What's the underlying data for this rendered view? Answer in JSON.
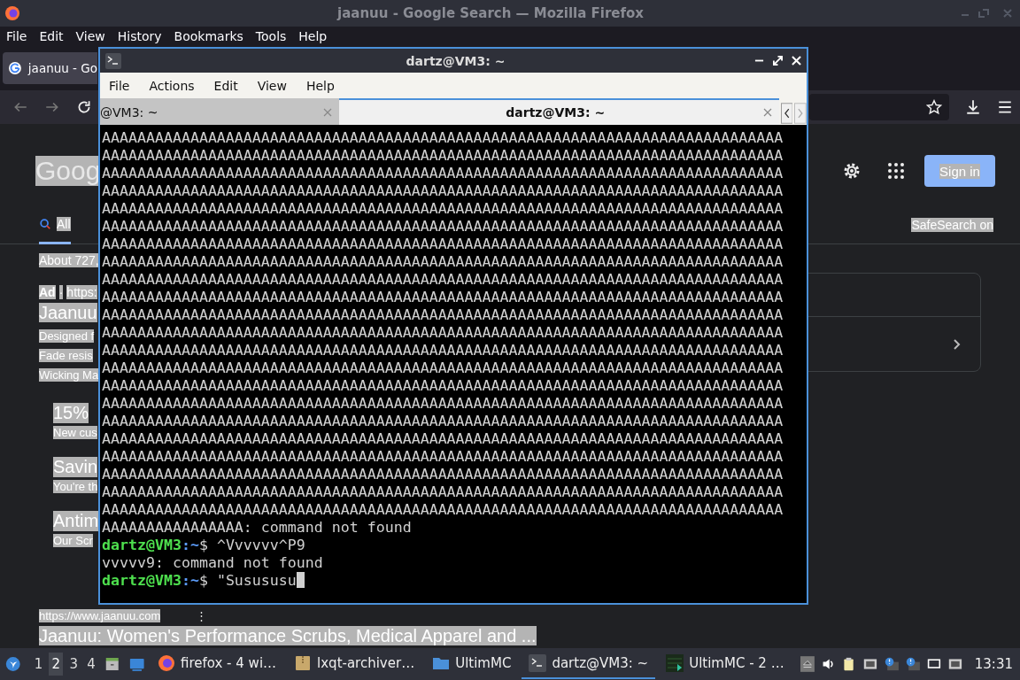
{
  "firefox": {
    "title": "jaanuu - Google Search — Mozilla Firefox",
    "menu": [
      "File",
      "Edit",
      "View",
      "History",
      "Bookmarks",
      "Tools",
      "Help"
    ],
    "tab": {
      "label": "jaanuu - Go",
      "selected": true
    },
    "google": {
      "logo": "Goog",
      "sign_in": "Sign in",
      "nav_tab": {
        "label": "All",
        "selected": true
      },
      "safesearch": "SafeSearch on",
      "results_left": [
        {
          "kind": "stats",
          "text": "About 727,"
        },
        {
          "kind": "adline",
          "badge": "Ad",
          "dot": "·",
          "text": "https:"
        },
        {
          "kind": "title",
          "text": "Jaanuu"
        },
        {
          "kind": "snippet",
          "text": "Designed f"
        },
        {
          "kind": "snippet",
          "text": "Fade resis"
        },
        {
          "kind": "snippet",
          "text": "Wicking Ma"
        },
        {
          "kind": "sublink",
          "title": "15%",
          "text": "New cus"
        },
        {
          "kind": "sublink",
          "title": "Savin",
          "text": "You're th"
        },
        {
          "kind": "sublink",
          "title": "Antim",
          "text": "Our Scr"
        }
      ],
      "organic": {
        "url": "https://www.jaanuu.com",
        "more": "⋮",
        "title": "Jaanuu: Women's Performance Scrubs, Medical Apparel and ..."
      }
    }
  },
  "terminal": {
    "title": "dartz@VM3: ~",
    "menu": [
      "File",
      "Actions",
      "Edit",
      "View",
      "Help"
    ],
    "tabs": [
      {
        "label": "@VM3: ~",
        "selected": false
      },
      {
        "label": "dartz@VM3: ~",
        "selected": true
      }
    ],
    "lines": [
      {
        "kind": "output",
        "text": "AAAAAAAAAAAAAAAAAAAAAAAAAAAAAAAAAAAAAAAAAAAAAAAAAAAAAAAAAAAAAAAAAAAAAAAAAAAAA"
      },
      {
        "kind": "output",
        "text": "AAAAAAAAAAAAAAAAAAAAAAAAAAAAAAAAAAAAAAAAAAAAAAAAAAAAAAAAAAAAAAAAAAAAAAAAAAAAA"
      },
      {
        "kind": "output",
        "text": "AAAAAAAAAAAAAAAAAAAAAAAAAAAAAAAAAAAAAAAAAAAAAAAAAAAAAAAAAAAAAAAAAAAAAAAAAAAAA"
      },
      {
        "kind": "output",
        "text": "AAAAAAAAAAAAAAAAAAAAAAAAAAAAAAAAAAAAAAAAAAAAAAAAAAAAAAAAAAAAAAAAAAAAAAAAAAAAA"
      },
      {
        "kind": "output",
        "text": "AAAAAAAAAAAAAAAAAAAAAAAAAAAAAAAAAAAAAAAAAAAAAAAAAAAAAAAAAAAAAAAAAAAAAAAAAAAAA"
      },
      {
        "kind": "output",
        "text": "AAAAAAAAAAAAAAAAAAAAAAAAAAAAAAAAAAAAAAAAAAAAAAAAAAAAAAAAAAAAAAAAAAAAAAAAAAAAA"
      },
      {
        "kind": "output",
        "text": "AAAAAAAAAAAAAAAAAAAAAAAAAAAAAAAAAAAAAAAAAAAAAAAAAAAAAAAAAAAAAAAAAAAAAAAAAAAAA"
      },
      {
        "kind": "output",
        "text": "AAAAAAAAAAAAAAAAAAAAAAAAAAAAAAAAAAAAAAAAAAAAAAAAAAAAAAAAAAAAAAAAAAAAAAAAAAAAA"
      },
      {
        "kind": "output",
        "text": "AAAAAAAAAAAAAAAAAAAAAAAAAAAAAAAAAAAAAAAAAAAAAAAAAAAAAAAAAAAAAAAAAAAAAAAAAAAAA"
      },
      {
        "kind": "output",
        "text": "AAAAAAAAAAAAAAAAAAAAAAAAAAAAAAAAAAAAAAAAAAAAAAAAAAAAAAAAAAAAAAAAAAAAAAAAAAAAA"
      },
      {
        "kind": "output",
        "text": "AAAAAAAAAAAAAAAAAAAAAAAAAAAAAAAAAAAAAAAAAAAAAAAAAAAAAAAAAAAAAAAAAAAAAAAAAAAAA"
      },
      {
        "kind": "output",
        "text": "AAAAAAAAAAAAAAAAAAAAAAAAAAAAAAAAAAAAAAAAAAAAAAAAAAAAAAAAAAAAAAAAAAAAAAAAAAAAA"
      },
      {
        "kind": "output",
        "text": "AAAAAAAAAAAAAAAAAAAAAAAAAAAAAAAAAAAAAAAAAAAAAAAAAAAAAAAAAAAAAAAAAAAAAAAAAAAAA"
      },
      {
        "kind": "output",
        "text": "AAAAAAAAAAAAAAAAAAAAAAAAAAAAAAAAAAAAAAAAAAAAAAAAAAAAAAAAAAAAAAAAAAAAAAAAAAAAA"
      },
      {
        "kind": "output",
        "text": "AAAAAAAAAAAAAAAAAAAAAAAAAAAAAAAAAAAAAAAAAAAAAAAAAAAAAAAAAAAAAAAAAAAAAAAAAAAAA"
      },
      {
        "kind": "output",
        "text": "AAAAAAAAAAAAAAAAAAAAAAAAAAAAAAAAAAAAAAAAAAAAAAAAAAAAAAAAAAAAAAAAAAAAAAAAAAAAA"
      },
      {
        "kind": "output",
        "text": "AAAAAAAAAAAAAAAAAAAAAAAAAAAAAAAAAAAAAAAAAAAAAAAAAAAAAAAAAAAAAAAAAAAAAAAAAAAAA"
      },
      {
        "kind": "output",
        "text": "AAAAAAAAAAAAAAAAAAAAAAAAAAAAAAAAAAAAAAAAAAAAAAAAAAAAAAAAAAAAAAAAAAAAAAAAAAAAA"
      },
      {
        "kind": "output",
        "text": "AAAAAAAAAAAAAAAAAAAAAAAAAAAAAAAAAAAAAAAAAAAAAAAAAAAAAAAAAAAAAAAAAAAAAAAAAAAAA"
      },
      {
        "kind": "output",
        "text": "AAAAAAAAAAAAAAAAAAAAAAAAAAAAAAAAAAAAAAAAAAAAAAAAAAAAAAAAAAAAAAAAAAAAAAAAAAAAA"
      },
      {
        "kind": "output",
        "text": "AAAAAAAAAAAAAAAAAAAAAAAAAAAAAAAAAAAAAAAAAAAAAAAAAAAAAAAAAAAAAAAAAAAAAAAAAAAAA"
      },
      {
        "kind": "output",
        "text": "AAAAAAAAAAAAAAAAAAAAAAAAAAAAAAAAAAAAAAAAAAAAAAAAAAAAAAAAAAAAAAAAAAAAAAAAAAAAA"
      },
      {
        "kind": "output",
        "text": "AAAAAAAAAAAAAAAA: command not found"
      },
      {
        "kind": "prompt",
        "user": "dartz@VM3",
        "path": ":~",
        "command": "$ ^Vvvvvv^P9"
      },
      {
        "kind": "output",
        "text": "vvvvv9: command not found"
      },
      {
        "kind": "prompt",
        "user": "dartz@VM3",
        "path": ":~",
        "command": "$ \"Susususu"
      }
    ]
  },
  "taskbar": {
    "workspaces": [
      {
        "label": "1",
        "selected": false
      },
      {
        "label": "2",
        "selected": true
      },
      {
        "label": "3",
        "selected": false
      },
      {
        "label": "4",
        "selected": false
      }
    ],
    "tasks": [
      {
        "kind": "firefox",
        "label": "firefox - 4 wi…",
        "selected": false
      },
      {
        "kind": "archive",
        "label": "lxqt-archiver…",
        "selected": false
      },
      {
        "kind": "folder",
        "label": "UltimMC",
        "selected": false
      },
      {
        "kind": "terminal",
        "label": "dartz@VM3: ~",
        "selected": true
      },
      {
        "kind": "game",
        "label": "UltimMC - 2 …",
        "selected": false
      }
    ],
    "clock": "13:31"
  }
}
